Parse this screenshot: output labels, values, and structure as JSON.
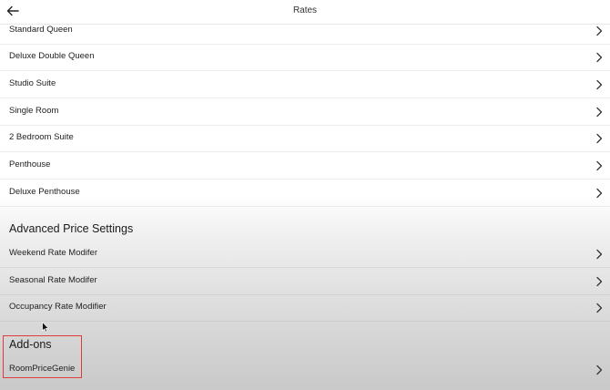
{
  "header": {
    "title": "Rates"
  },
  "room_rates": [
    {
      "label": "Standard Queen"
    },
    {
      "label": "Deluxe Double Queen"
    },
    {
      "label": "Studio Suite"
    },
    {
      "label": "Single Room"
    },
    {
      "label": "2 Bedroom Suite"
    },
    {
      "label": "Penthouse"
    },
    {
      "label": "Deluxe Penthouse"
    }
  ],
  "advanced": {
    "title": "Advanced Price Settings",
    "items": [
      {
        "label": "Weekend Rate Modifer"
      },
      {
        "label": "Seasonal Rate Modifer"
      },
      {
        "label": "Occupancy Rate Modifier"
      }
    ]
  },
  "addons": {
    "title": "Add-ons",
    "items": [
      {
        "label": "RoomPriceGenie"
      }
    ]
  },
  "colors": {
    "highlight_border": "#e03a3a"
  },
  "icons": {
    "back": "arrow-left-icon",
    "row_chevron": "chevron-right-icon"
  }
}
